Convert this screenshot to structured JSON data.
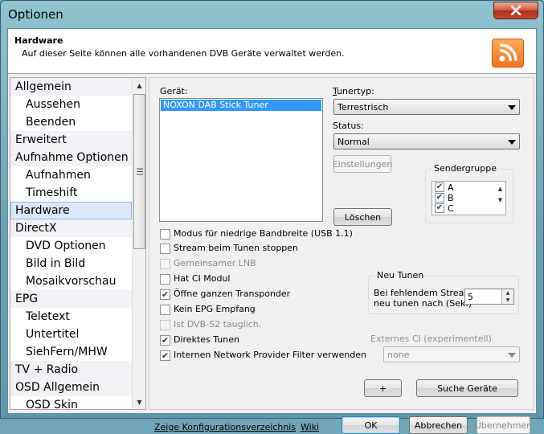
{
  "window": {
    "title": "Optionen"
  },
  "header": {
    "title": "Hardware",
    "description": "Auf dieser Seite können alle vorhandenen DVB Geräte verwaltet werden."
  },
  "nav": {
    "items": [
      {
        "label": "Allgemein",
        "level": 0
      },
      {
        "label": "Aussehen",
        "level": 1
      },
      {
        "label": "Beenden",
        "level": 1
      },
      {
        "label": "Erweitert",
        "level": 0
      },
      {
        "label": "Aufnahme Optionen",
        "level": 0
      },
      {
        "label": "Aufnahmen",
        "level": 1
      },
      {
        "label": "Timeshift",
        "level": 1
      },
      {
        "label": "Hardware",
        "level": 0,
        "selected": true
      },
      {
        "label": "DirectX",
        "level": 0
      },
      {
        "label": "DVD Optionen",
        "level": 1
      },
      {
        "label": "Bild in Bild",
        "level": 1
      },
      {
        "label": "Mosaikvorschau",
        "level": 1
      },
      {
        "label": "EPG",
        "level": 0
      },
      {
        "label": "Teletext",
        "level": 1
      },
      {
        "label": "Untertitel",
        "level": 1
      },
      {
        "label": "SiehFern/MHW",
        "level": 1
      },
      {
        "label": "TV + Radio",
        "level": 0
      },
      {
        "label": "OSD Allgemein",
        "level": 0
      },
      {
        "label": "OSD Skin",
        "level": 1
      }
    ]
  },
  "devices": {
    "label": "Gerät:",
    "items": [
      "NOXON DAB Stick Tuner"
    ],
    "selected": "NOXON DAB Stick Tuner"
  },
  "tuner": {
    "label": "Tunertyp:",
    "value": "Terrestrisch"
  },
  "status": {
    "label": "Status:",
    "value": "Normal"
  },
  "buttons": {
    "einstellungen": "Einstellungen",
    "loeschen": "Löschen",
    "plus": "+",
    "suche": "Suche Geräte",
    "ok": "OK",
    "abbrechen": "Abbrechen",
    "uebernehmen": "Übernehmen"
  },
  "sendergruppe": {
    "title": "Sendergruppe",
    "items": [
      {
        "label": "A",
        "checked": true
      },
      {
        "label": "B",
        "checked": true
      },
      {
        "label": "C",
        "checked": true
      }
    ]
  },
  "options": [
    {
      "label": "Modus für niedrige Bandbreite (USB 1.1)",
      "checked": false,
      "enabled": true
    },
    {
      "label": "Stream beim Tunen stoppen",
      "checked": false,
      "enabled": true
    },
    {
      "label": "Gemeinsamer LNB",
      "checked": false,
      "enabled": false
    },
    {
      "label": "Hat CI Modul",
      "checked": false,
      "enabled": true
    },
    {
      "label": "Öffne ganzen Transponder",
      "checked": true,
      "enabled": true
    },
    {
      "label": "Kein EPG Empfang",
      "checked": false,
      "enabled": true
    },
    {
      "label": "Ist DVB-S2 tauglich.",
      "checked": false,
      "enabled": false
    },
    {
      "label": "Direktes Tunen",
      "checked": true,
      "enabled": true
    },
    {
      "label": "Internen Network Provider Filter verwenden",
      "checked": true,
      "enabled": true
    }
  ],
  "neu_tunen": {
    "title": "Neu Tunen",
    "line1": "Bei fehlendem Stream",
    "line2": "neu tunen nach (Sek.)",
    "value": "5"
  },
  "externes_ci": {
    "label": "Externes CI (experimentell)",
    "value": "none"
  },
  "footer": {
    "config_link": "Zeige Konfigurationsverzeichnis",
    "wiki_link": "Wiki"
  }
}
